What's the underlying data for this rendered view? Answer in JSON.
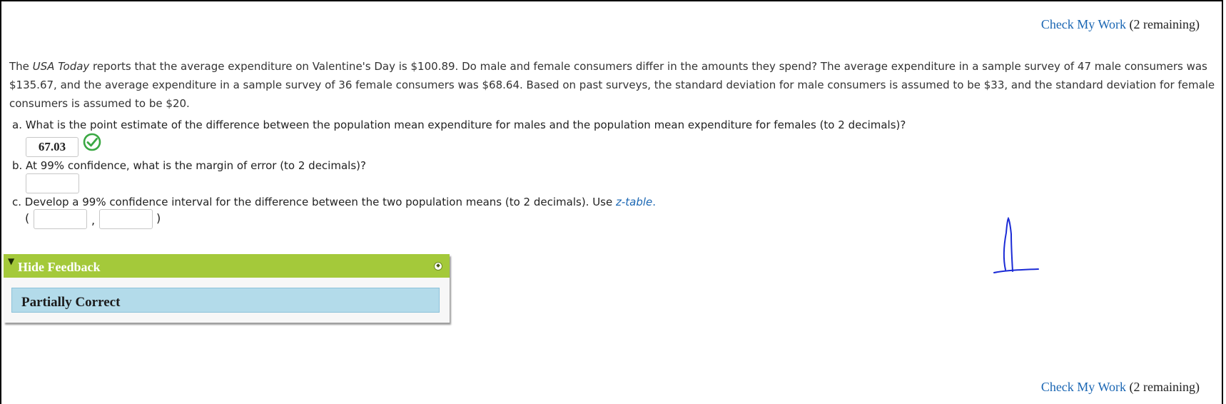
{
  "check_my_work": {
    "link_label": "Check My Work",
    "remaining_label": "(2 remaining)"
  },
  "problem": {
    "intro_pre": "The ",
    "source": "USA Today",
    "intro_post": " reports that the average expenditure on Valentine's Day is $100.89. Do male and female consumers differ in the amounts they spend? The average expenditure in a sample survey of 47 male consumers was $135.67, and the average expenditure in a sample survey of 36 female consumers was $68.64. Based on past surveys, the standard deviation for male consumers is assumed to be $33, and the standard deviation for female consumers is assumed to be $20."
  },
  "questions": {
    "a": {
      "text": "a. What is the point estimate of the difference between the population mean expenditure for males and the population mean expenditure for females (to 2 decimals)?",
      "answer": "67.03",
      "status_icon": "check-circle-icon"
    },
    "b": {
      "text": "b. At 99% confidence, what is the margin of error (to 2 decimals)?",
      "answer": ""
    },
    "c": {
      "text_pre": "c. Develop a 99% confidence interval for the difference between the two population means (to 2 decimals). Use ",
      "link": "z-table",
      "link_tail": ".",
      "lower": "",
      "upper": "",
      "open_paren": "(",
      "comma": ",",
      "close_paren": ")"
    }
  },
  "feedback": {
    "toggle_label": "Hide Feedback",
    "status": "Partially Correct",
    "header_color": "#a4c93a",
    "status_color": "#b3dbea"
  },
  "colors": {
    "link": "#1a66b3",
    "check": "#3aa843"
  }
}
